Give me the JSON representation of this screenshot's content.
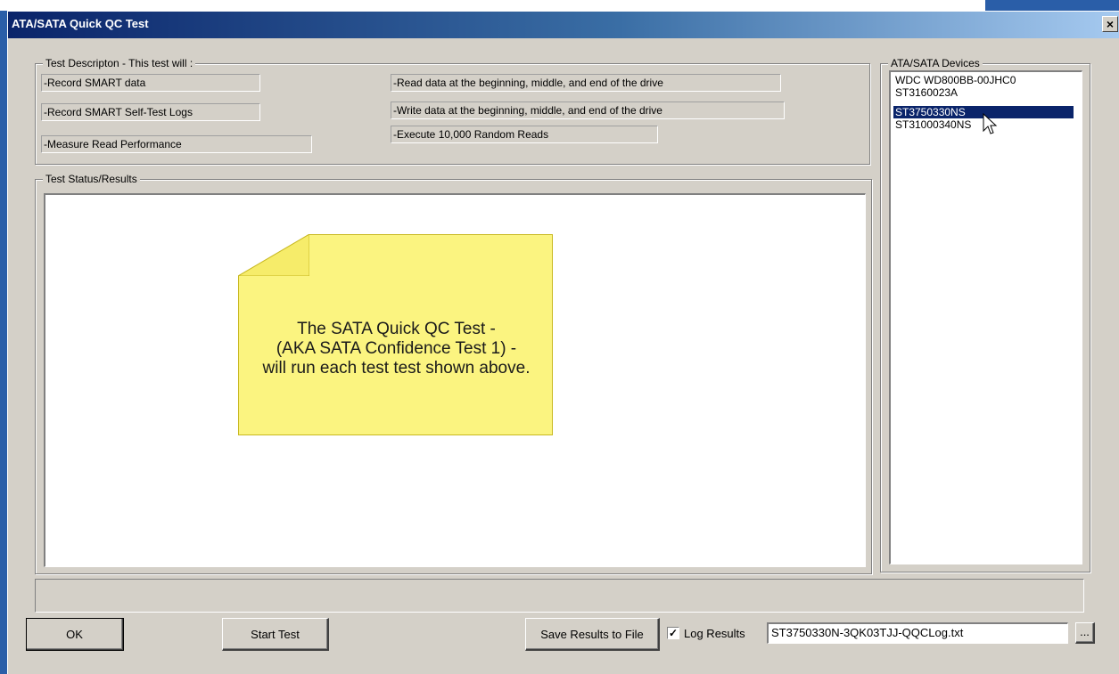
{
  "window": {
    "title": "ATA/SATA Quick QC Test",
    "close_glyph": "×"
  },
  "description": {
    "legend": "Test Descripton - This test will :",
    "items": [
      "-Record SMART data",
      "-Record SMART Self-Test Logs",
      "-Measure Read Performance",
      "-Read data at the beginning, middle, and end of the drive",
      "-Write data at the beginning, middle, and end of the drive",
      "-Execute 10,000 Random Reads"
    ]
  },
  "results": {
    "legend": "Test Status/Results",
    "note_lines": [
      "The SATA Quick QC Test -",
      "(AKA SATA Confidence Test 1) -",
      "will run each test test shown above."
    ],
    "note_color": "#fbf480"
  },
  "devices": {
    "legend": "ATA/SATA Devices",
    "items": [
      "WDC WD800BB-00JHC0",
      "ST3160023A",
      "ST3750330NS",
      "ST31000340NS"
    ],
    "selected_index": 2
  },
  "buttons": {
    "ok": "OK",
    "start": "Start Test",
    "save": "Save Results to File",
    "browse": "..."
  },
  "log": {
    "label": "Log Results",
    "checked": true,
    "check_glyph": "✓",
    "filename": "ST3750330N-3QK03TJJ-QQCLog.txt"
  },
  "colors": {
    "title_start": "#0a246a",
    "dialog_bg": "#d4d0c8",
    "selection": "#0a246a"
  }
}
